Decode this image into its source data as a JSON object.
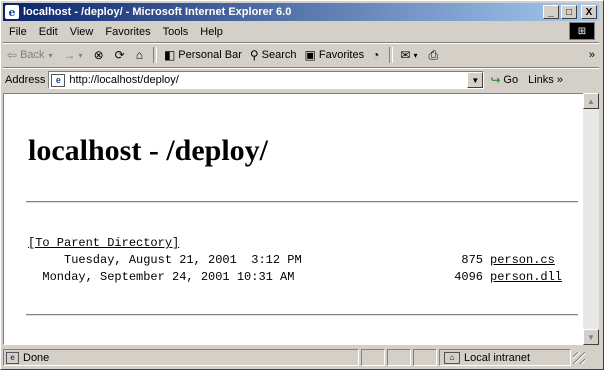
{
  "window": {
    "title": "localhost - /deploy/ - Microsoft Internet Explorer 6.0",
    "minimize": "_",
    "maximize": "□",
    "close": "X"
  },
  "menu": [
    "File",
    "Edit",
    "View",
    "Favorites",
    "Tools",
    "Help"
  ],
  "toolbar": {
    "back": "Back",
    "forward": "→",
    "stop": "⊗",
    "refresh": "⟳",
    "home": "⌂",
    "personal_bar": "Personal Bar",
    "search": "Search",
    "favorites": "Favorites",
    "more": "»"
  },
  "address": {
    "label": "Address",
    "url": "http://localhost/deploy/",
    "go": "Go",
    "links": "Links",
    "links_more": "»"
  },
  "page": {
    "heading": "localhost - /deploy/",
    "parent_link": "[To Parent Directory]",
    "files": [
      {
        "datetime": "     Tuesday, August 21, 2001  3:12 PM",
        "size": "  875",
        "name": "person.cs"
      },
      {
        "datetime": "  Monday, September 24, 2001 10:31 AM",
        "size": " 4096",
        "name": "person.dll"
      }
    ]
  },
  "status": {
    "text": "Done",
    "zone": "Local intranet"
  }
}
